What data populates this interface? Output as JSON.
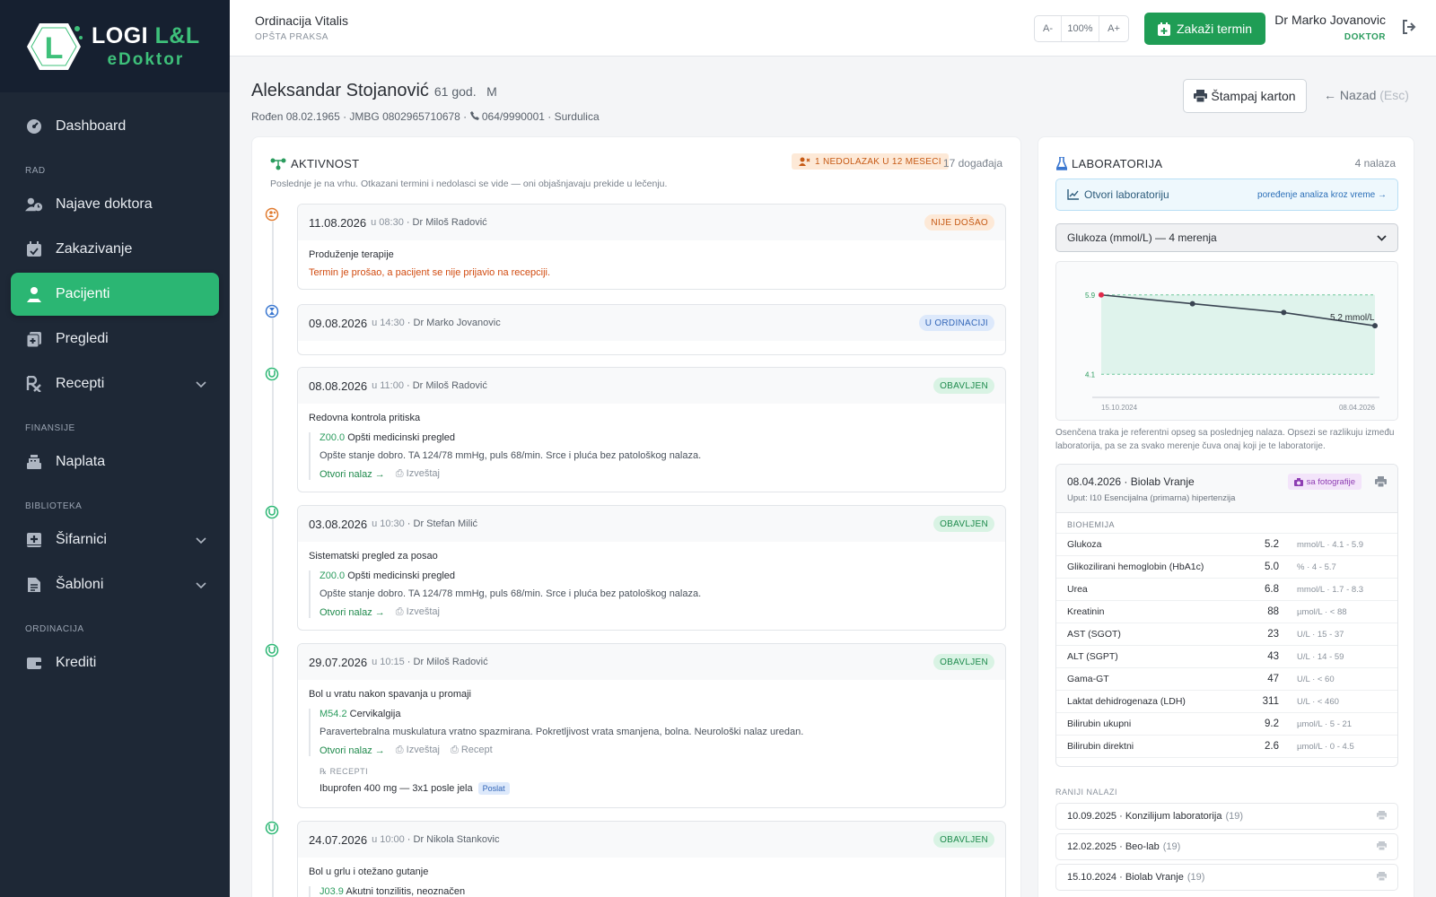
{
  "brand": {
    "title_a": "LOGI ",
    "title_b": "L&L",
    "sub": "eDoktor"
  },
  "nav": {
    "dashboard": "Dashboard",
    "sec_rad": "RAD",
    "najave": "Najave doktora",
    "zakazivanje": "Zakazivanje",
    "pacijenti": "Pacijenti",
    "pregledi": "Pregledi",
    "recepti": "Recepti",
    "sec_finansije": "FINANSIJE",
    "naplata": "Naplata",
    "sec_biblioteka": "BIBLIOTEKA",
    "sifarnici": "Šifarnici",
    "sabloni": "Šabloni",
    "sec_ordinacija": "ORDINACIJA",
    "krediti": "Krediti"
  },
  "topbar": {
    "clinic": "Ordinacija Vitalis",
    "clinic_sub": "OPŠTA PRAKSA",
    "zoom_minus": "A-",
    "zoom_value": "100%",
    "zoom_plus": "A+",
    "zakazi": "Zakaži termin",
    "doctor": "Dr Marko Jovanovic",
    "role": "DOKTOR"
  },
  "patient": {
    "name": "Aleksandar Stojanović",
    "age": "61 god.",
    "sex": "M",
    "meta_a": "Rođen 08.02.1965 · JMBG 0802965710678 · ",
    "phone": "064/9990001",
    "meta_b": " · Surdulica",
    "print": "Štampaj karton",
    "back": "Nazad",
    "back_key": "(Esc)"
  },
  "activity": {
    "title": "AKTIVNOST",
    "noshow_badge": "1 NEDOLAZAK U 12 MESECI",
    "count": "17 događaja",
    "desc": "Poslednje je na vrhu. Otkazani termini i nedolasci se vide — oni objašnjavaju prekide u lečenju.",
    "open": "Otvori nalaz",
    "report": "Izveštaj",
    "recipe": "Recept",
    "rx_header": "RECEPTI",
    "events": [
      {
        "date": "11.08.2026",
        "time": "u 08:30",
        "doctor": "· Dr Miloš Radović",
        "status": "NIJE DOŠAO",
        "reason": "Produženje terapije",
        "warn": "Termin je prošao, a pacijent se nije prijavio na recepciji."
      },
      {
        "date": "09.08.2026",
        "time": "u 14:30",
        "doctor": "· Dr Marko Jovanovic",
        "status": "U ORDINACIJI"
      },
      {
        "date": "08.08.2026",
        "time": "u 11:00",
        "doctor": "· Dr Miloš Radović",
        "status": "OBAVLJEN",
        "reason": "Redovna kontrola pritiska",
        "code": "Z00.0",
        "dx": "Opšti medicinski pregled",
        "note": "Opšte stanje dobro. TA 124/78 mmHg, puls 68/min. Srce i pluća bez patološkog nalaza."
      },
      {
        "date": "03.08.2026",
        "time": "u 10:30",
        "doctor": "· Dr Stefan Milić",
        "status": "OBAVLJEN",
        "reason": "Sistematski pregled za posao",
        "code": "Z00.0",
        "dx": "Opšti medicinski pregled",
        "note": "Opšte stanje dobro. TA 124/78 mmHg, puls 68/min. Srce i pluća bez patološkog nalaza."
      },
      {
        "date": "29.07.2026",
        "time": "u 10:15",
        "doctor": "· Dr Miloš Radović",
        "status": "OBAVLJEN",
        "reason": "Bol u vratu nakon spavanja u promaji",
        "code": "M54.2",
        "dx": "Cervikalgija",
        "note": "Paravertebralna muskulatura vratno spazmirana. Pokretljivost vrata smanjena, bolna. Neurološki nalaz uredan.",
        "rx": "Ibuprofen 400 mg — 3x1 posle jela",
        "rx_status": "Poslat"
      },
      {
        "date": "24.07.2026",
        "time": "u 10:00",
        "doctor": "· Dr Nikola Stankovic",
        "status": "OBAVLJEN",
        "reason": "Bol u grlu i otežano gutanje",
        "code": "J03.9",
        "dx": "Akutni tonzilitis, neoznačen"
      }
    ]
  },
  "lab": {
    "title": "LABORATORIJA",
    "count": "4 nalaza",
    "open": "Otvori laboratoriju",
    "compare": "poređenje analiza kroz vreme",
    "select": "Glukoza (mmol/L) — 4 merenja",
    "note": "Osenčena traka je referentni opseg sa poslednjeg nalaza. Opsezi se razlikuju između laboratorija, pa se za svako merenje čuva onaj koji je te laboratorije.",
    "report_title": "08.04.2026 · Biolab Vranje",
    "photo": "sa fotografije",
    "referral": "Uput: I10 Esencijalna (primarna) hipertenzija",
    "group": "BIOHEMIJA",
    "rows": [
      {
        "name": "Glukoza",
        "value": "5.2",
        "range": "mmol/L · 4.1 - 5.9"
      },
      {
        "name": "Glikozilirani hemoglobin (HbA1c)",
        "value": "5.0",
        "range": "% · 4 - 5.7"
      },
      {
        "name": "Urea",
        "value": "6.8",
        "range": "mmol/L · 1.7 - 8.3"
      },
      {
        "name": "Kreatinin",
        "value": "88",
        "range": "µmol/L · < 88"
      },
      {
        "name": "AST (SGOT)",
        "value": "23",
        "range": "U/L · 15 - 37"
      },
      {
        "name": "ALT (SGPT)",
        "value": "43",
        "range": "U/L · 14 - 59"
      },
      {
        "name": "Gama-GT",
        "value": "47",
        "range": "U/L · < 60"
      },
      {
        "name": "Laktat dehidrogenaza (LDH)",
        "value": "311",
        "range": "U/L · < 460"
      },
      {
        "name": "Bilirubin ukupni",
        "value": "9.2",
        "range": "µmol/L · 5 - 21"
      },
      {
        "name": "Bilirubin direktni",
        "value": "2.6",
        "range": "µmol/L · 0 - 4.5"
      }
    ],
    "earlier_header": "RANIJI NALAZI",
    "earlier": [
      {
        "label": "10.09.2025 · Konzilijum laboratorija",
        "count": "(19)"
      },
      {
        "label": "12.02.2025 · Beo-lab",
        "count": "(19)"
      },
      {
        "label": "15.10.2024 · Biolab Vranje",
        "count": "(19)"
      }
    ]
  },
  "chart_data": {
    "type": "line",
    "x": [
      "15.10.2024",
      "12.02.2025",
      "10.09.2025",
      "08.04.2026"
    ],
    "values": [
      5.9,
      5.7,
      5.5,
      5.2
    ],
    "ref_range": [
      4.1,
      5.9
    ],
    "yticks": [
      "5.9",
      "4.1"
    ],
    "xticks": [
      "15.10.2024",
      "08.04.2026"
    ],
    "last_label": "5.2 mmol/L",
    "colors": {
      "line": "#3a4452",
      "band": "#dff3ec",
      "high": "#e0294a"
    }
  }
}
